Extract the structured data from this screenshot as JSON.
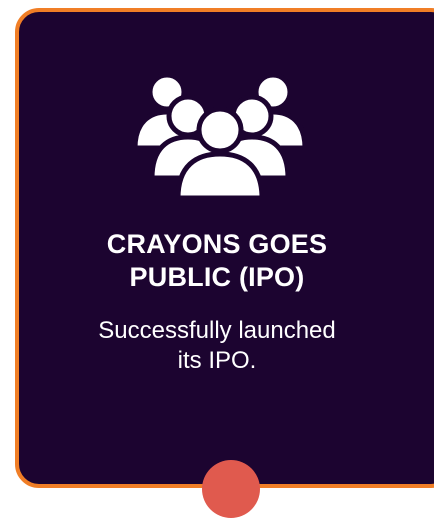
{
  "card": {
    "title_lines": [
      "CRAYONS GOES",
      "PUBLIC (IPO)"
    ],
    "description_lines": [
      "Successfully launched",
      "its IPO."
    ],
    "icon": "people-group-icon",
    "border_color": "#f07e26",
    "background_color": "#1c0430",
    "marker_color": "#e05a4e"
  }
}
